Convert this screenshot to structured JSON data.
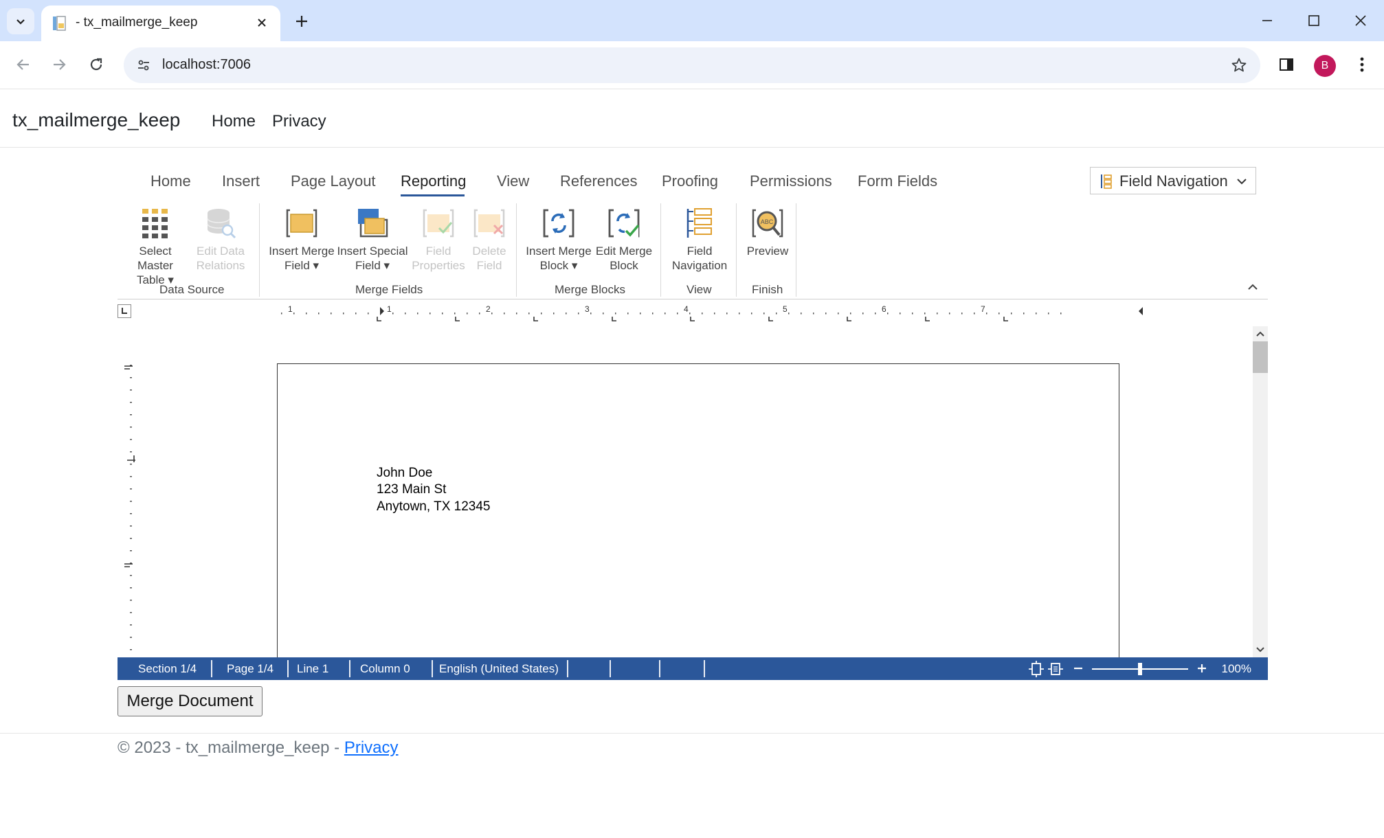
{
  "browser": {
    "tab_title": "- tx_mailmerge_keep",
    "url": "localhost:7006",
    "avatar_letter": "B"
  },
  "site": {
    "brand": "tx_mailmerge_keep",
    "nav": [
      "Home",
      "Privacy"
    ]
  },
  "ribbon": {
    "tabs": [
      "Home",
      "Insert",
      "Page Layout",
      "Reporting",
      "View",
      "References",
      "Proofing",
      "Permissions",
      "Form Fields"
    ],
    "active_tab": "Reporting",
    "field_navigation_dropdown": "Field Navigation",
    "groups": {
      "data_source": "Data Source",
      "merge_fields": "Merge Fields",
      "merge_blocks": "Merge Blocks",
      "view": "View",
      "finish": "Finish"
    },
    "buttons": {
      "select_master_table": [
        "Select Master",
        "Table ▾"
      ],
      "edit_data_relations": [
        "Edit Data",
        "Relations"
      ],
      "insert_merge_field": [
        "Insert Merge",
        "Field ▾"
      ],
      "insert_special_field": [
        "Insert Special",
        "Field ▾"
      ],
      "field_properties": [
        "Field",
        "Properties"
      ],
      "delete_field": [
        "Delete",
        "Field"
      ],
      "insert_merge_block": [
        "Insert Merge",
        "Block ▾"
      ],
      "edit_merge_block": [
        "Edit Merge",
        "Block"
      ],
      "field_navigation": [
        "Field",
        "Navigation"
      ],
      "preview": [
        "Preview"
      ]
    }
  },
  "document": {
    "address_lines": [
      "John Doe",
      "123 Main St",
      "Anytown, TX 12345"
    ]
  },
  "ruler": {
    "numbers": [
      "1",
      "1",
      "2",
      "3",
      "4",
      "5",
      "6",
      "7"
    ]
  },
  "statusbar": {
    "section": "Section 1/4",
    "page": "Page 1/4",
    "line": "Line 1",
    "column": "Column 0",
    "language": "English (United States)",
    "zoom": "100%",
    "zoom_level_percent": 100
  },
  "merge_button": "Merge Document",
  "footer": {
    "text": "© 2023 - tx_mailmerge_keep - ",
    "link": "Privacy"
  }
}
